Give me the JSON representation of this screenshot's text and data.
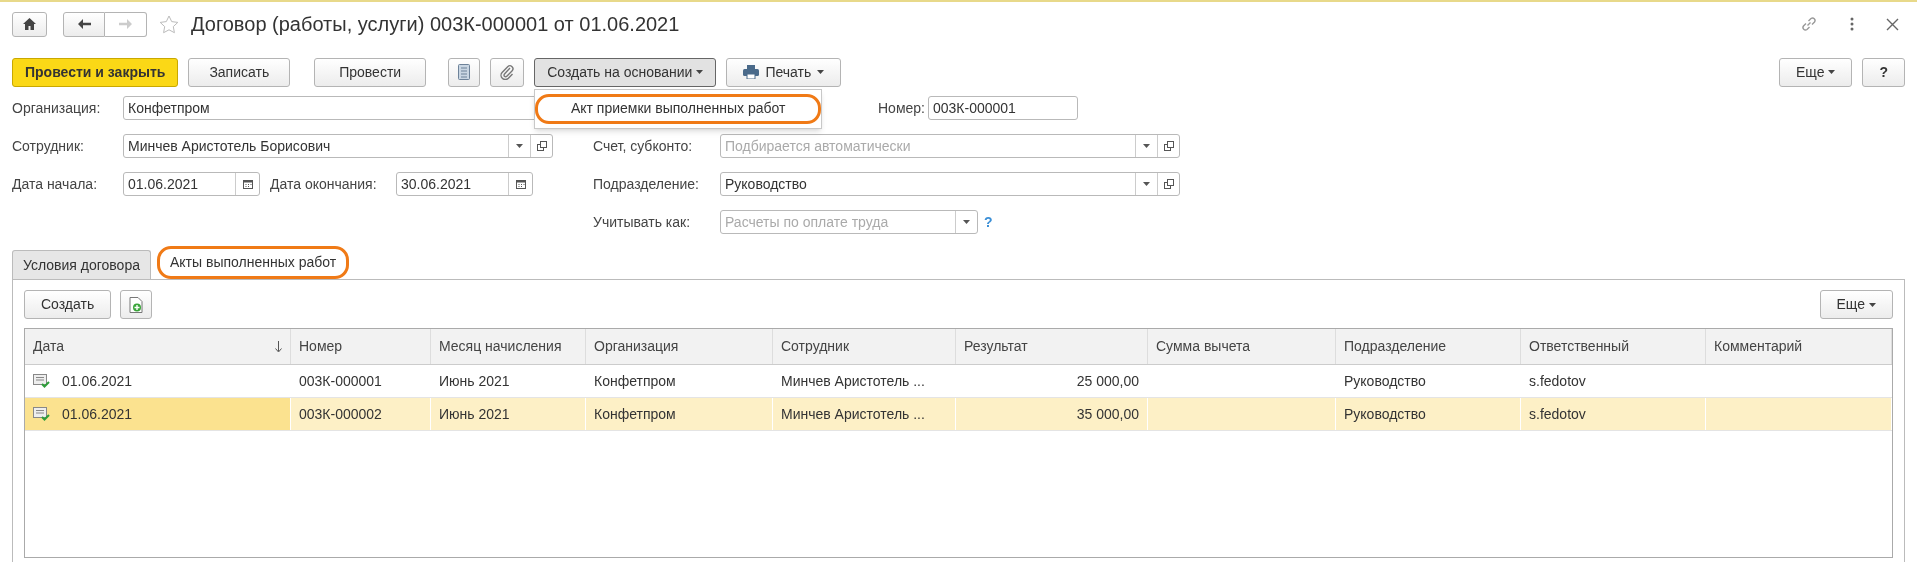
{
  "window": {
    "title": "Договор (работы, услуги) 003К-000001 от 01.06.2021",
    "favorite": false
  },
  "toolbar": {
    "buttons": [
      {
        "label": "Провести и закрыть",
        "kind": "primary"
      },
      {
        "label": "Записать",
        "kind": "plain"
      },
      {
        "label": "Провести",
        "kind": "plain"
      },
      {
        "kind": "structure"
      },
      {
        "kind": "attach"
      },
      {
        "label": "Создать на основании",
        "kind": "menu",
        "expanded": true
      },
      {
        "label": "Печать",
        "kind": "print"
      }
    ],
    "right_buttons": [
      {
        "label": "Еще",
        "kind": "menu"
      },
      {
        "label": "?",
        "kind": "help"
      }
    ],
    "menu": {
      "items": [
        {
          "label": "Акт приемки выполненных работ",
          "highlighted": true
        }
      ]
    }
  },
  "form": {
    "fields": [
      {
        "label": "Организация:",
        "value": "Конфетпром"
      },
      {
        "label": "Номер:",
        "value": "003К-000001"
      },
      {
        "label": "Сотрудник:",
        "value": "Минчев Аристотель Борисович",
        "dropdown": true,
        "open": true
      },
      {
        "label": "Счет, субконто:",
        "placeholder": "Подбирается автоматически",
        "dropdown": true,
        "open": true
      },
      {
        "label": "Дата начала:",
        "value": "01.06.2021",
        "calendar": true
      },
      {
        "label": "Дата окончания:",
        "value": "30.06.2021",
        "calendar": true
      },
      {
        "label": "Подразделение:",
        "value": "Руководство",
        "dropdown": true,
        "open": true
      },
      {
        "label": "Учитывать как:",
        "placeholder": "Расчеты по оплате труда",
        "dropdown": true,
        "help": "?"
      }
    ]
  },
  "tabs": [
    {
      "label": "Условия договора",
      "selected": false,
      "highlighted": false
    },
    {
      "label": "Акты выполненных работ",
      "selected": true,
      "highlighted": true
    }
  ],
  "list_toolbar": {
    "create": "Создать",
    "more": "Еще"
  },
  "table": {
    "columns": [
      "Дата",
      "Номер",
      "Месяц начисления",
      "Организация",
      "Сотрудник",
      "Результат",
      "Сумма вычета",
      "Подразделение",
      "Ответственный",
      "Комментарий"
    ],
    "rows": [
      {
        "selected": false,
        "cells": [
          "01.06.2021",
          "003К-000001",
          "Июнь 2021",
          "Конфетпром",
          "Минчев Аристотель ...",
          "25 000,00",
          "",
          "Руководство",
          "s.fedotov",
          ""
        ]
      },
      {
        "selected": true,
        "cells": [
          "01.06.2021",
          "003К-000002",
          "Июнь 2021",
          "Конфетпром",
          "Минчев Аристотель ...",
          "35 000,00",
          "",
          "Руководство",
          "s.fedotov",
          ""
        ]
      }
    ]
  }
}
